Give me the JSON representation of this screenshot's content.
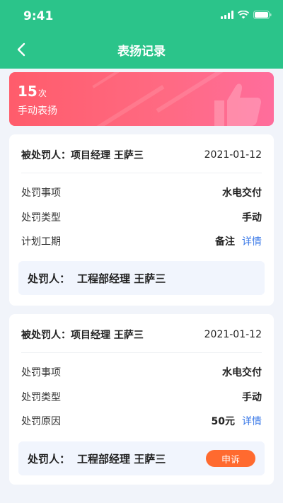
{
  "status_bar": {
    "time": "9:41"
  },
  "nav": {
    "title": "表扬记录",
    "back_icon": "chevron-left-icon"
  },
  "banner": {
    "count": "15",
    "unit": "次",
    "label": "手动表扬",
    "icon": "thumbs-up-icon"
  },
  "cards": [
    {
      "who_label": "被处罚人：",
      "who_name": "项目经理 王萨三",
      "date": "2021-01-12",
      "rows": [
        {
          "label": "处罚事项",
          "value": "水电交付"
        },
        {
          "label": "处罚类型",
          "value": "手动"
        },
        {
          "label": "计划工期",
          "value": "备注",
          "link": "详情"
        }
      ],
      "footer_label": "处罚人：",
      "footer_name": "工程部经理 王萨三"
    },
    {
      "who_label": "被处罚人：",
      "who_name": "项目经理 王萨三",
      "date": "2021-01-12",
      "rows": [
        {
          "label": "处罚事项",
          "value": "水电交付"
        },
        {
          "label": "处罚类型",
          "value": "手动"
        },
        {
          "label": "处罚原因",
          "value": "50元",
          "link": "详情"
        }
      ],
      "footer_label": "处罚人：",
      "footer_name": "工程部经理 王萨三",
      "action": "申诉"
    }
  ],
  "colors": {
    "header": "#2bc48a",
    "banner": "#ff5c6b",
    "link": "#3b7ae8",
    "appeal": "#ff6a2f"
  }
}
